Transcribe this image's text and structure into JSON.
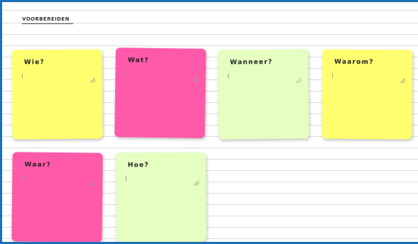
{
  "section": {
    "title": "VOORBEREIDEN"
  },
  "notes": [
    {
      "label": "Wie?",
      "color": "#ffff70"
    },
    {
      "label": "Wat?",
      "color": "#ff59a9"
    },
    {
      "label": "Wanneer?",
      "color": "#e5ffc1"
    },
    {
      "label": "Waarom?",
      "color": "#ffff70"
    },
    {
      "label": "Waar?",
      "color": "#ff59a9"
    },
    {
      "label": "Hoe?",
      "color": "#e5ffc1"
    }
  ]
}
